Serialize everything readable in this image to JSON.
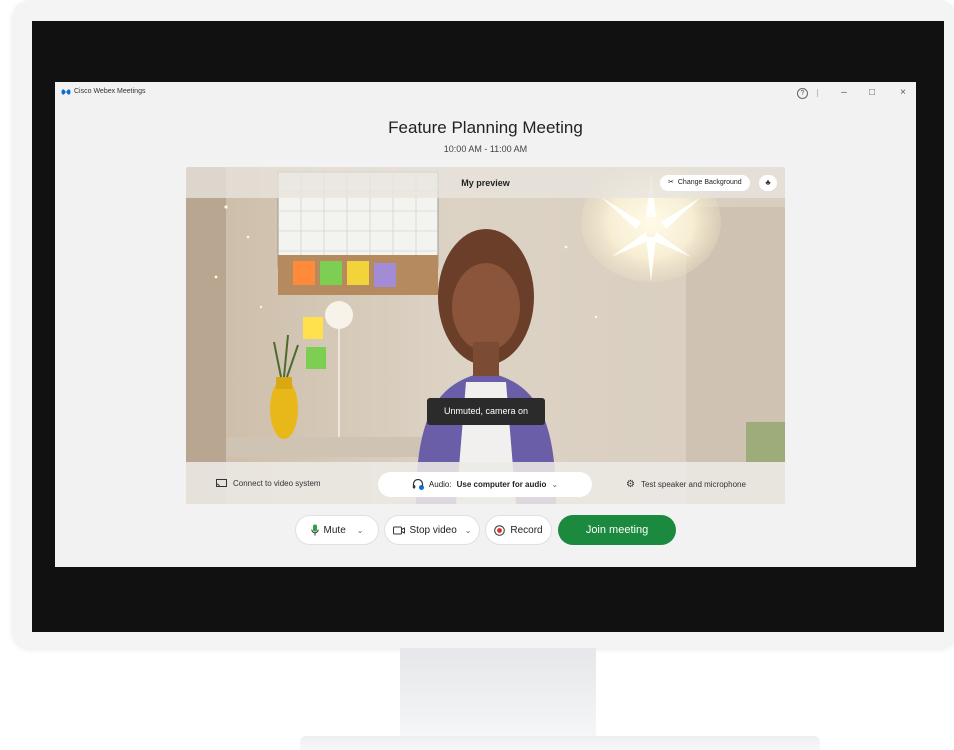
{
  "app": {
    "name": "Cisco Webex Meetings",
    "accent_color": "#1b8a3f",
    "logo_color": "#0b6fd1"
  },
  "window_controls": {
    "icons": [
      "help-icon",
      "minimize-icon",
      "maximize-icon",
      "close-icon"
    ],
    "help_glyph": "?",
    "minimize_glyph": "–",
    "maximize_glyph": "□",
    "close_glyph": "×"
  },
  "meeting": {
    "title": "Feature Planning Meeting",
    "time": "10:00 AM - 11:00 AM"
  },
  "preview": {
    "label": "My preview",
    "change_background_label": "Change Background",
    "status_tooltip": "Unmuted, camera on"
  },
  "preview_footer": {
    "connect_label": "Connect to video system",
    "audio_prefix": "Audio:",
    "audio_value": "Use computer for audio",
    "test_label": "Test speaker and microphone"
  },
  "controls": {
    "mute_label": "Mute",
    "stop_video_label": "Stop video",
    "record_label": "Record",
    "join_label": "Join meeting"
  }
}
